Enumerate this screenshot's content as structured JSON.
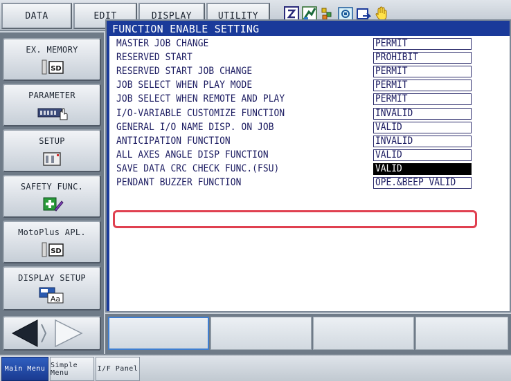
{
  "topmenu": {
    "data": "DATA",
    "edit": "EDIT",
    "display": "DISPLAY",
    "utility": "UTILITY"
  },
  "status_icons": [
    "mode-icon",
    "robot-icon",
    "coordinate-icon",
    "tool-icon",
    "job-icon",
    "hand-icon"
  ],
  "leftmenu": {
    "ex_memory": "EX. MEMORY",
    "parameter": "PARAMETER",
    "setup": "SETUP",
    "safety_func": "SAFETY FUNC.",
    "motoplus": "MotoPlus APL.",
    "display_setup": "DISPLAY SETUP",
    "sd_text": "SD",
    "aa_text": "Aa"
  },
  "window": {
    "title": "FUNCTION ENABLE SETTING"
  },
  "settings": [
    {
      "label": "MASTER JOB CHANGE",
      "value": "PERMIT"
    },
    {
      "label": "RESERVED START",
      "value": "PROHIBIT"
    },
    {
      "label": "RESERVED START JOB CHANGE",
      "value": "PERMIT"
    },
    {
      "label": "JOB SELECT WHEN PLAY MODE",
      "value": "PERMIT"
    },
    {
      "label": "JOB SELECT WHEN REMOTE AND PLAY",
      "value": "PERMIT"
    },
    {
      "label": "I/O-VARIABLE CUSTOMIZE FUNCTION",
      "value": "INVALID"
    },
    {
      "label": "GENERAL I/O NAME DISP. ON JOB",
      "value": "VALID"
    },
    {
      "label": "ANTICIPATION FUNCTION",
      "value": "INVALID"
    },
    {
      "label": "ALL AXES ANGLE DISP FUNCTION",
      "value": "VALID"
    },
    {
      "label": "SAVE DATA CRC CHECK FUNC.(FSU)",
      "value": "VALID"
    },
    {
      "label": "PENDANT BUZZER FUNCTION",
      "value": "OPE.&BEEP VALID"
    }
  ],
  "tabs": {
    "main_menu": "Main Menu",
    "simple_menu": "Simple Menu",
    "if_panel": "I/F Panel"
  },
  "colors": {
    "title_bar": "#1a3a9a",
    "highlight": "#e04050",
    "selected_value_bg": "#000000"
  }
}
